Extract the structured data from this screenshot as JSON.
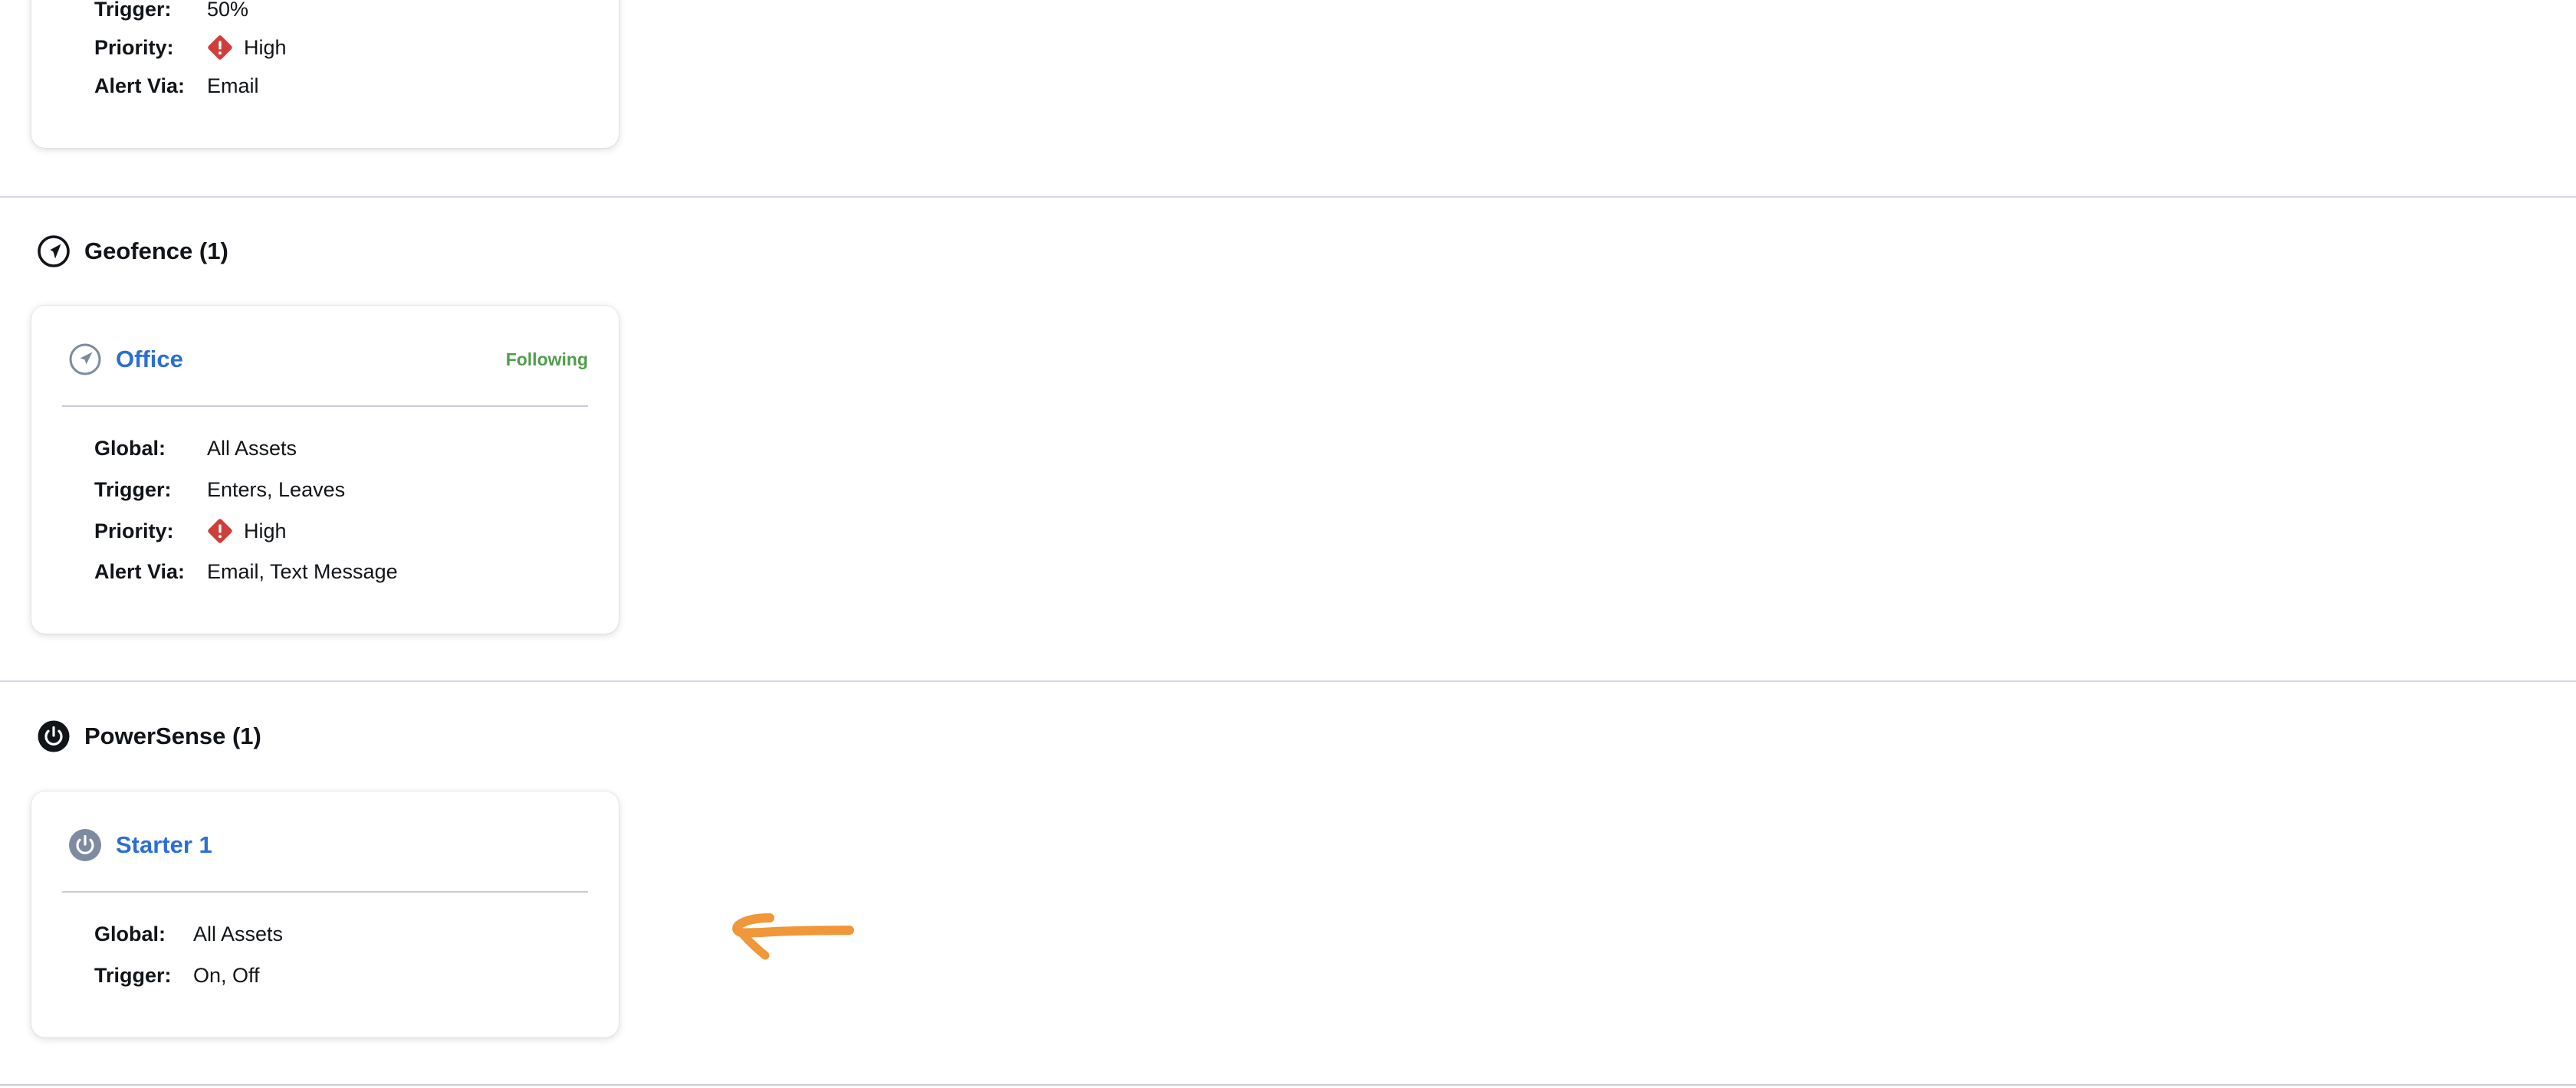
{
  "top_card": {
    "rows": [
      {
        "label": "Trigger:",
        "value": "50%"
      },
      {
        "label": "Priority:",
        "value": "High"
      },
      {
        "label": "Alert Via:",
        "value": "Email"
      }
    ]
  },
  "geofence": {
    "section_title": "Geofence (1)",
    "card": {
      "title": "Office",
      "status": "Following",
      "rows": [
        {
          "label": "Global:",
          "value": "All Assets"
        },
        {
          "label": "Trigger:",
          "value": "Enters, Leaves"
        },
        {
          "label": "Priority:",
          "value": "High"
        },
        {
          "label": "Alert Via:",
          "value": "Email, Text Message"
        }
      ]
    }
  },
  "powersense": {
    "section_title": "PowerSense (1)",
    "card": {
      "title": "Starter 1",
      "rows": [
        {
          "label": "Global:",
          "value": "All Assets"
        },
        {
          "label": "Trigger:",
          "value": "On, Off"
        }
      ]
    }
  },
  "colors": {
    "link_title": "#2c6fd3",
    "status_following": "#4f9d4a",
    "priority_high": "#cf3f3a",
    "annotation_arrow": "#f0973a"
  },
  "icons": {
    "priority": "diamond-exclamation-icon",
    "geofence": "navigation-arrow-circle-icon",
    "powersense": "power-icon"
  }
}
